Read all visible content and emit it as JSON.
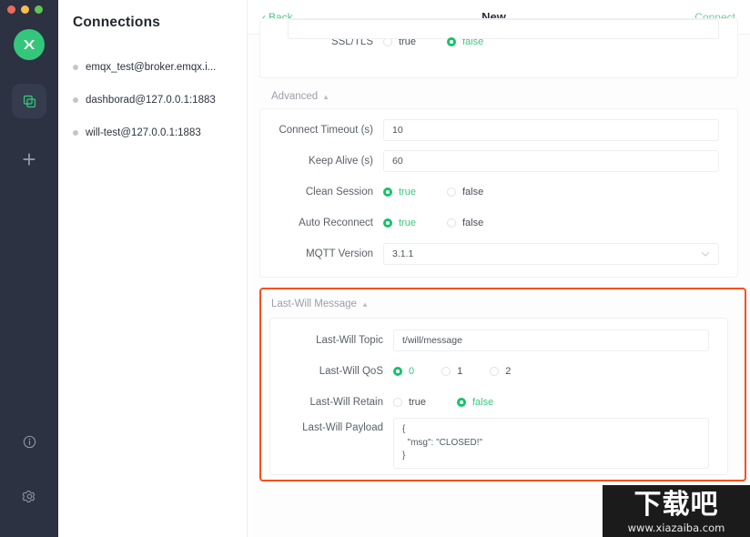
{
  "window": {
    "traffic_lights": [
      "close",
      "minimize",
      "maximize"
    ]
  },
  "rail": {
    "logo_name": "emqx-logo",
    "items": [
      {
        "icon": "copy-stack-icon",
        "active": true
      },
      {
        "icon": "plus-icon",
        "label": "+",
        "active": false
      }
    ],
    "bottom_items": [
      {
        "icon": "info-icon"
      },
      {
        "icon": "gear-icon"
      }
    ]
  },
  "connections": {
    "title": "Connections",
    "items": [
      {
        "name": "emqx_test@broker.emqx.i..."
      },
      {
        "name": "dashborad@127.0.0.1:1883"
      },
      {
        "name": "will-test@127.0.0.1:1883"
      }
    ]
  },
  "topbar": {
    "back_label": "Back",
    "back_chevron": "‹",
    "title": "New",
    "connect_label": "Connect"
  },
  "ssl": {
    "label": "SSL/TLS",
    "options": [
      {
        "label": "true",
        "selected": false
      },
      {
        "label": "false",
        "selected": true
      }
    ]
  },
  "advanced": {
    "title": "Advanced",
    "collapse_glyph": "▲",
    "connect_timeout": {
      "label": "Connect Timeout (s)",
      "value": "10"
    },
    "keep_alive": {
      "label": "Keep Alive (s)",
      "value": "60"
    },
    "clean_session": {
      "label": "Clean Session",
      "options": [
        {
          "label": "true",
          "selected": true
        },
        {
          "label": "false",
          "selected": false
        }
      ]
    },
    "auto_reconnect": {
      "label": "Auto Reconnect",
      "options": [
        {
          "label": "true",
          "selected": true
        },
        {
          "label": "false",
          "selected": false
        }
      ]
    },
    "mqtt_version": {
      "label": "MQTT Version",
      "value": "3.1.1",
      "caret": "⌄"
    }
  },
  "last_will": {
    "title": "Last-Will Message",
    "collapse_glyph": "▲",
    "topic": {
      "label": "Last-Will Topic",
      "value": "t/will/message"
    },
    "qos": {
      "label": "Last-Will QoS",
      "options": [
        {
          "label": "0",
          "selected": true
        },
        {
          "label": "1",
          "selected": false
        },
        {
          "label": "2",
          "selected": false
        }
      ]
    },
    "retain": {
      "label": "Last-Will Retain",
      "options": [
        {
          "label": "true",
          "selected": false
        },
        {
          "label": "false",
          "selected": true
        }
      ]
    },
    "payload": {
      "label": "Last-Will Payload",
      "value": "{\n  \"msg\": \"CLOSED!\"\n}"
    },
    "highlight_color": "#f4511e"
  },
  "watermark": {
    "title": "下载吧",
    "url": "www.xiazaiba.com"
  },
  "colors": {
    "accent_green": "#16c26a",
    "link_green": "#48c783",
    "rail_bg": "#2c3242",
    "highlight": "#f4511e"
  }
}
